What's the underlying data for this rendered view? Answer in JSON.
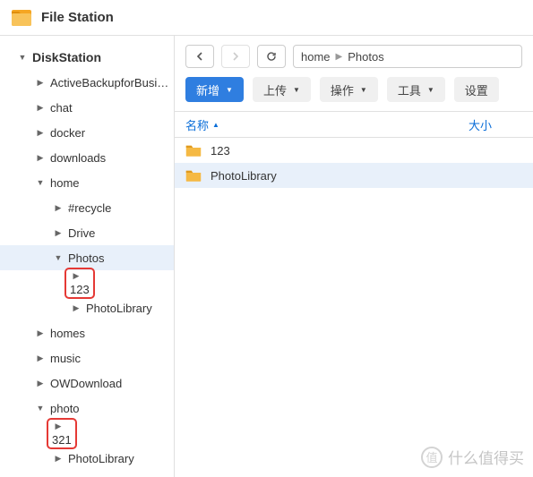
{
  "app": {
    "title": "File Station"
  },
  "sidebar": {
    "root": "DiskStation",
    "items": [
      {
        "label": "ActiveBackupforBusiness",
        "expanded": false,
        "depth": 1
      },
      {
        "label": "chat",
        "expanded": false,
        "depth": 1
      },
      {
        "label": "docker",
        "expanded": false,
        "depth": 1
      },
      {
        "label": "downloads",
        "expanded": false,
        "depth": 1
      },
      {
        "label": "home",
        "expanded": true,
        "depth": 1
      },
      {
        "label": "#recycle",
        "expanded": false,
        "depth": 2
      },
      {
        "label": "Drive",
        "expanded": false,
        "depth": 2
      },
      {
        "label": "Photos",
        "expanded": true,
        "depth": 2,
        "selected": true
      },
      {
        "label": "123",
        "expanded": false,
        "depth": 3,
        "highlight": true
      },
      {
        "label": "PhotoLibrary",
        "expanded": false,
        "depth": 3
      },
      {
        "label": "homes",
        "expanded": false,
        "depth": 1
      },
      {
        "label": "music",
        "expanded": false,
        "depth": 1
      },
      {
        "label": "OWDownload",
        "expanded": false,
        "depth": 1
      },
      {
        "label": "photo",
        "expanded": true,
        "depth": 1
      },
      {
        "label": "321",
        "expanded": false,
        "depth": 2,
        "highlight": true
      },
      {
        "label": "PhotoLibrary",
        "expanded": false,
        "depth": 2
      }
    ]
  },
  "breadcrumb": [
    "home",
    "Photos"
  ],
  "toolbar": {
    "new": "新增",
    "upload": "上传",
    "action": "操作",
    "tools": "工具",
    "settings": "设置"
  },
  "columns": {
    "name": "名称",
    "size": "大小"
  },
  "files": [
    {
      "name": "123",
      "selected": false
    },
    {
      "name": "PhotoLibrary",
      "selected": true
    }
  ],
  "watermark": "什么值得买"
}
